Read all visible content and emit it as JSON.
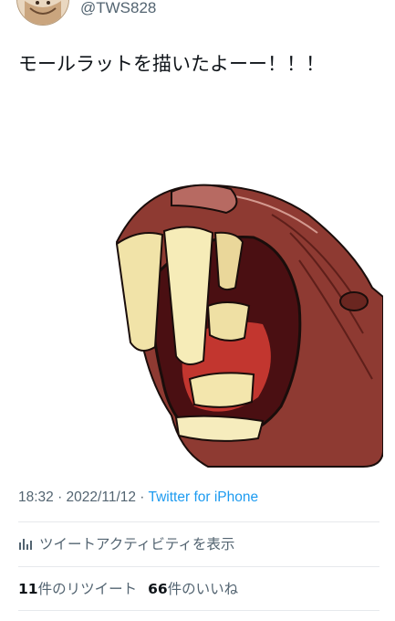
{
  "user": {
    "handle": "@TWS828",
    "avatar_icon": "user-avatar"
  },
  "tweet": {
    "text": "モールラットを描いたよーー！！！",
    "timestamp": "18:32 · 2022/11/12",
    "separator": " · ",
    "source": "Twitter for iPhone",
    "media_icon": "mole-rat-illustration"
  },
  "activity": {
    "label": "ツイートアクティビティを表示",
    "icon": "bar-chart-icon"
  },
  "stats": {
    "retweets_count": "11",
    "retweets_label": "件のリツイート",
    "likes_count": "66",
    "likes_label": "件のいいね"
  },
  "colors": {
    "text": "#0f1419",
    "secondary": "#536471",
    "link": "#1d9bf0",
    "divider": "#e6e9ec"
  }
}
